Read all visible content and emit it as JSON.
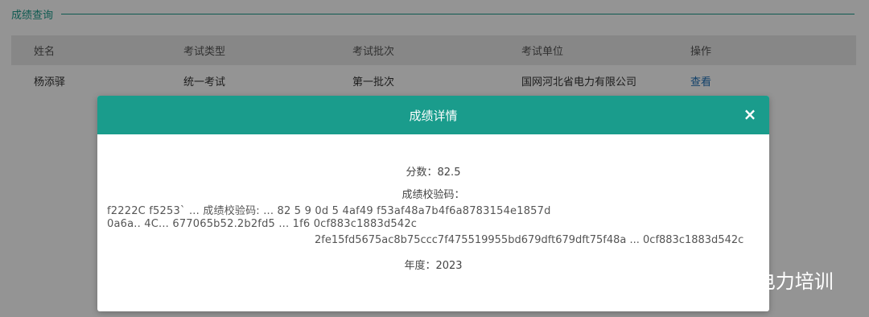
{
  "section": {
    "title": "成绩查询"
  },
  "table": {
    "headers": [
      "姓名",
      "考试类型",
      "考试批次",
      "考试单位",
      "操作"
    ],
    "rows": [
      {
        "name": "杨添驿",
        "type": "统一考试",
        "batch": "第一批次",
        "unit": "国网河北省电力有限公司",
        "action": "查看"
      }
    ]
  },
  "modal": {
    "title": "成绩详情",
    "close_glyph": "×",
    "score_line": "分数：82.5",
    "verify_label": "成绩校验码：",
    "verify_line1": "f2222C  f5253`  ...  成绩校验码:  ...  82 5 9 0d 5 4af49  f53af48a7b4f6a8783154e1857d",
    "verify_line2": "0a6a..  4C...  677065b52.2b2fd5  ...  1f6  0cf883c1883d542c",
    "verify_line3": "2fe15fd5675ac8b75ccc7f475519955bd679dft679dft75f48a ... 0cf883c1883d542c",
    "year_line": "年度：2023"
  },
  "watermark": {
    "text": "vivi电力培训",
    "icon": "wechat-icon"
  }
}
